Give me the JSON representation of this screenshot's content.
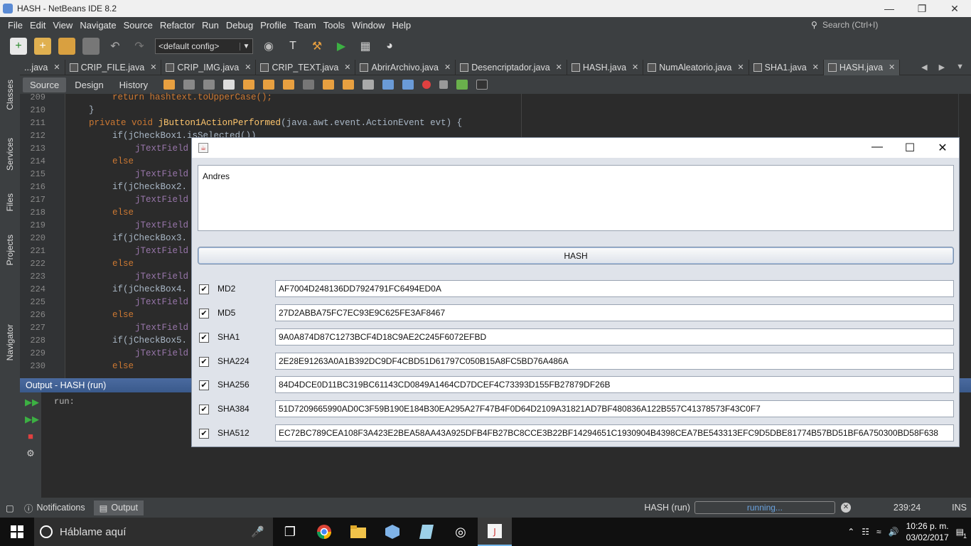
{
  "window": {
    "title": "HASH - NetBeans IDE 8.2"
  },
  "menu": [
    "File",
    "Edit",
    "View",
    "Navigate",
    "Source",
    "Refactor",
    "Run",
    "Debug",
    "Profile",
    "Team",
    "Tools",
    "Window",
    "Help"
  ],
  "search": {
    "placeholder": "Search (Ctrl+I)"
  },
  "toolbar": {
    "config": "<default config>"
  },
  "side_tabs": [
    "Classes",
    "Services",
    "Files",
    "Projects",
    "Navigator"
  ],
  "file_tabs": [
    {
      "label": "...java"
    },
    {
      "label": "CRIP_FILE.java"
    },
    {
      "label": "CRIP_IMG.java"
    },
    {
      "label": "CRIP_TEXT.java"
    },
    {
      "label": "AbrirArchivo.java"
    },
    {
      "label": "Desencriptador.java"
    },
    {
      "label": "HASH.java"
    },
    {
      "label": "NumAleatorio.java"
    },
    {
      "label": "SHA1.java"
    },
    {
      "label": "HASH.java"
    }
  ],
  "editor_tabs": {
    "source": "Source",
    "design": "Design",
    "history": "History"
  },
  "code": {
    "lines": [
      "209",
      "210",
      "211",
      "212",
      "213",
      "214",
      "215",
      "216",
      "217",
      "218",
      "219",
      "220",
      "221",
      "222",
      "223",
      "224",
      "225",
      "226",
      "227",
      "228",
      "229",
      "230"
    ],
    "l209": "return hashtext.toUpperCase();",
    "l210": "}",
    "l211_kw": "private void ",
    "l211_fn": "jButton1ActionPerformed",
    "l211_rest": "(java.awt.event.ActionEvent evt) {",
    "if1": "if(jCheckBox1.isSelected())",
    "tf": "jTextField",
    "else": "else",
    "if2": "if(jCheckBox2.",
    "if3": "if(jCheckBox3.",
    "if4": "if(jCheckBox4.",
    "if5": "if(jCheckBox5."
  },
  "output": {
    "title": "Output - HASH (run)",
    "text": "run:"
  },
  "statusbar": {
    "notifications": "Notifications",
    "output": "Output",
    "task": "HASH (run)",
    "progress": "running...",
    "position": "239:24",
    "mode": "INS"
  },
  "taskbar": {
    "search_placeholder": "Háblame aquí",
    "time": "10:26 p. m.",
    "date": "03/02/2017",
    "notif_count": "1"
  },
  "dialog": {
    "input_text": "Andres",
    "button_label": "HASH",
    "rows": [
      {
        "label": "MD2",
        "checked": true,
        "value": "AF7004D248136DD7924791FC6494ED0A"
      },
      {
        "label": "MD5",
        "checked": true,
        "value": "27D2ABBA75FC7EC93E9C625FE3AF8467"
      },
      {
        "label": "SHA1",
        "checked": true,
        "value": "9A0A874D87C1273BCF4D18C9AE2C245F6072EFBD"
      },
      {
        "label": "SHA224",
        "checked": true,
        "value": "2E28E91263A0A1B392DC9DF4CBD51D61797C050B15A8FC5BD76A486A"
      },
      {
        "label": "SHA256",
        "checked": true,
        "value": "84D4DCE0D11BC319BC61143CD0849A1464CD7DCEF4C73393D155FB27879DF26B"
      },
      {
        "label": "SHA384",
        "checked": true,
        "value": "51D7209665990AD0C3F59B190E184B30EA295A27F47B4F0D64D2109A31821AD7BF480836A122B557C41378573F43C0F7"
      },
      {
        "label": "SHA512",
        "checked": true,
        "value": "EC72BC789CEA108F3A423E2BEA58AA43A925DFB4FB27BC8CCE3B22BF14294651C1930904B4398CEA7BE543313EFC9D5DBE81774B57BD51BF6A750300BD58F638"
      }
    ]
  },
  "colors": {
    "ide_bg": "#3c3f41",
    "editor_bg": "#2b2b2b",
    "keyword": "#cc7832",
    "method": "#ffc66d",
    "output_header": "#3a5a8c"
  }
}
